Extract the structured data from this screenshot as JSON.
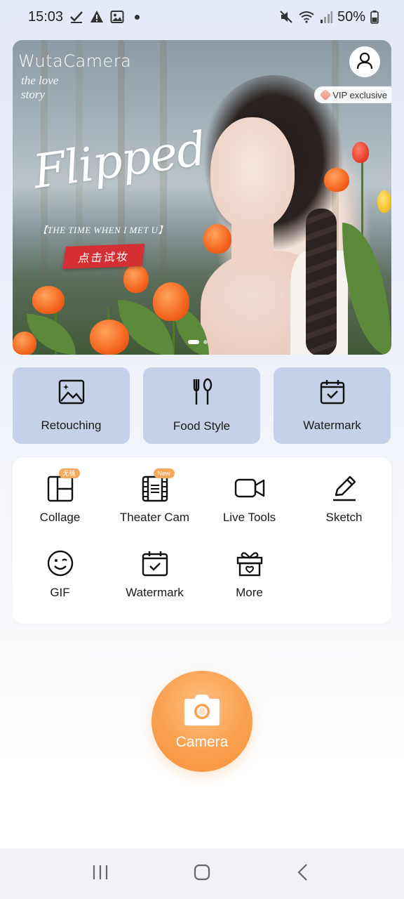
{
  "status_bar": {
    "time": "15:03",
    "battery": "50%",
    "icons_left": [
      "check-icon",
      "warning-icon",
      "image-icon",
      "dot-icon"
    ],
    "icons_right": [
      "mute-icon",
      "wifi-icon",
      "signal-icon",
      "battery-icon"
    ]
  },
  "banner": {
    "brand": "WutaCamera",
    "subtitle_line1": "the love",
    "subtitle_line2": "story",
    "headline": "Flipped",
    "tagline": "【THE TIME WHEN I MET U】",
    "cta": "点击试妆",
    "vip_label": "VIP exclusive",
    "page_count": 2,
    "active_page": 1
  },
  "quick_actions": [
    {
      "label": "Retouching",
      "icon": "image-sparkle-icon"
    },
    {
      "label": "Food Style",
      "icon": "fork-spoon-icon"
    },
    {
      "label": "Watermark",
      "icon": "calendar-check-icon"
    }
  ],
  "tools": [
    {
      "label": "Collage",
      "icon": "collage-icon",
      "badge": "无缝"
    },
    {
      "label": "Theater Cam",
      "icon": "film-icon",
      "badge": "New"
    },
    {
      "label": "Live Tools",
      "icon": "video-icon",
      "badge": ""
    },
    {
      "label": "Sketch",
      "icon": "pencil-icon",
      "badge": ""
    },
    {
      "label": "GIF",
      "icon": "wink-face-icon",
      "badge": ""
    },
    {
      "label": "Watermark",
      "icon": "calendar-check-icon",
      "badge": ""
    },
    {
      "label": "More",
      "icon": "gift-icon",
      "badge": ""
    }
  ],
  "camera": {
    "label": "Camera",
    "icon": "camera-icon"
  },
  "nav": [
    "recent-apps-icon",
    "home-icon",
    "back-icon"
  ],
  "colors": {
    "quick_card": "#c6d0e8",
    "camera_orange": "#f9a04f",
    "cta_red": "#d42f32",
    "badge_orange": "#f6a95b"
  }
}
